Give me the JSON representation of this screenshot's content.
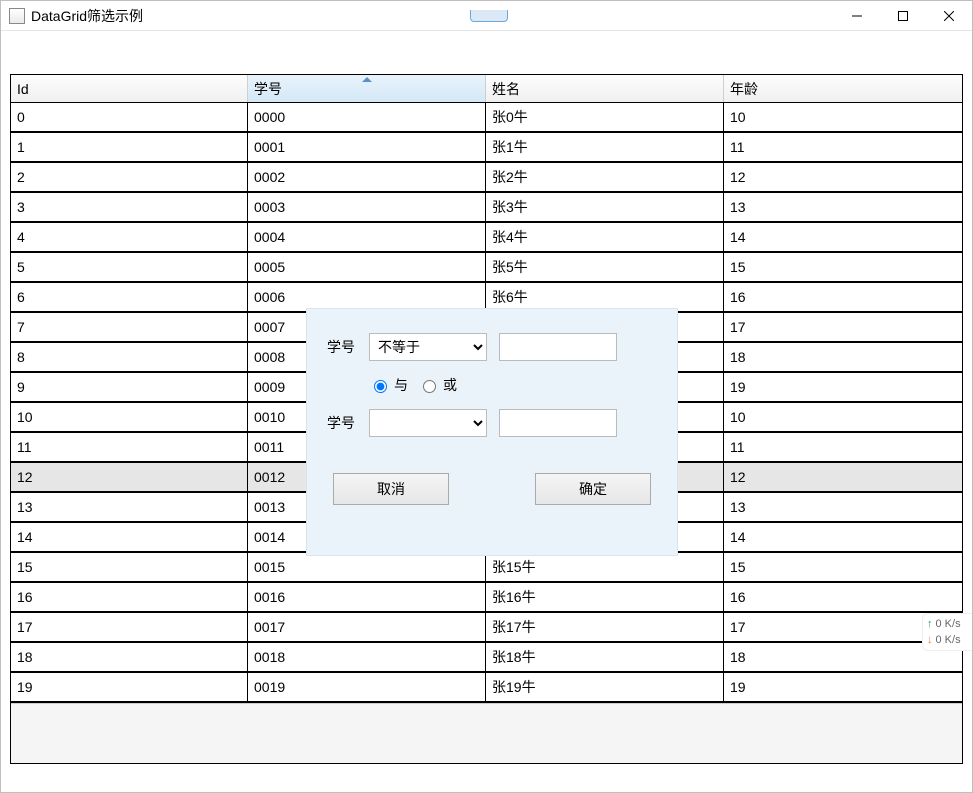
{
  "window": {
    "title": "DataGrid筛选示例"
  },
  "grid": {
    "columns": {
      "id": "Id",
      "sn": "学号",
      "name": "姓名",
      "age": "年龄"
    },
    "sorted_column": "sn",
    "highlight_index": 12,
    "rows": [
      {
        "id": "0",
        "sn": "0000",
        "name": "张0牛",
        "age": "10"
      },
      {
        "id": "1",
        "sn": "0001",
        "name": "张1牛",
        "age": "11"
      },
      {
        "id": "2",
        "sn": "0002",
        "name": "张2牛",
        "age": "12"
      },
      {
        "id": "3",
        "sn": "0003",
        "name": "张3牛",
        "age": "13"
      },
      {
        "id": "4",
        "sn": "0004",
        "name": "张4牛",
        "age": "14"
      },
      {
        "id": "5",
        "sn": "0005",
        "name": "张5牛",
        "age": "15"
      },
      {
        "id": "6",
        "sn": "0006",
        "name": "张6牛",
        "age": "16"
      },
      {
        "id": "7",
        "sn": "0007",
        "name": "",
        "age": "17"
      },
      {
        "id": "8",
        "sn": "0008",
        "name": "",
        "age": "18"
      },
      {
        "id": "9",
        "sn": "0009",
        "name": "",
        "age": "19"
      },
      {
        "id": "10",
        "sn": "0010",
        "name": "",
        "age": "10"
      },
      {
        "id": "11",
        "sn": "0011",
        "name": "",
        "age": "11"
      },
      {
        "id": "12",
        "sn": "0012",
        "name": "",
        "age": "12"
      },
      {
        "id": "13",
        "sn": "0013",
        "name": "",
        "age": "13"
      },
      {
        "id": "14",
        "sn": "0014",
        "name": "",
        "age": "14"
      },
      {
        "id": "15",
        "sn": "0015",
        "name": "张15牛",
        "age": "15"
      },
      {
        "id": "16",
        "sn": "0016",
        "name": "张16牛",
        "age": "16"
      },
      {
        "id": "17",
        "sn": "0017",
        "name": "张17牛",
        "age": "17"
      },
      {
        "id": "18",
        "sn": "0018",
        "name": "张18牛",
        "age": "18"
      },
      {
        "id": "19",
        "sn": "0019",
        "name": "张19牛",
        "age": "19"
      }
    ]
  },
  "filter": {
    "field1_label": "学号",
    "op1_selected": "不等于",
    "op1_options": [
      "不等于"
    ],
    "value1": "",
    "logic_and": "与",
    "logic_or": "或",
    "logic_selected": "and",
    "field2_label": "学号",
    "op2_selected": "",
    "op2_options": [
      ""
    ],
    "value2": "",
    "cancel_label": "取消",
    "ok_label": "确定"
  },
  "net": {
    "up": "0  K/s",
    "down": "0  K/s"
  }
}
